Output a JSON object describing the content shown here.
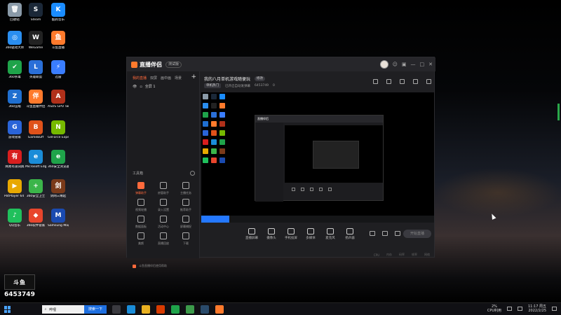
{
  "desktop": {
    "icons": [
      {
        "label": "回收站",
        "color": "#8a9aa8",
        "glyph": "🗑"
      },
      {
        "label": "Steam",
        "color": "#1b2838",
        "glyph": "S"
      },
      {
        "label": "酷狗音乐",
        "color": "#1a8cff",
        "glyph": "K"
      },
      {
        "label": "360驱动大师",
        "color": "#2a8ef0",
        "glyph": "◎"
      },
      {
        "label": "WeGame",
        "color": "#222222",
        "glyph": "W"
      },
      {
        "label": "斗鱼直播",
        "color": "#ff7a2c",
        "glyph": "鱼"
      },
      {
        "label": "360杀毒",
        "color": "#1fa34a",
        "glyph": "✔"
      },
      {
        "label": "英雄联盟",
        "color": "#2a6fd8",
        "glyph": "L"
      },
      {
        "label": "迅雷",
        "color": "#3a7dff",
        "glyph": "⚡"
      },
      {
        "label": "360压缩",
        "color": "#1f6fd0",
        "glyph": "Z"
      },
      {
        "label": "斗鱼直播伴侣",
        "color": "#ff7a2c",
        "glyph": "伴"
      },
      {
        "label": "ASUS GPU Tweak II",
        "color": "#b0301a",
        "glyph": "A"
      },
      {
        "label": "游戏管家",
        "color": "#2a64d8",
        "glyph": "G"
      },
      {
        "label": "GameBuff",
        "color": "#e0521a",
        "glyph": "B"
      },
      {
        "label": "GeForce Experience",
        "color": "#76b900",
        "glyph": "N"
      },
      {
        "label": "网易有道词典",
        "color": "#d81e1e",
        "glyph": "有"
      },
      {
        "label": "Microsoft Edge",
        "color": "#1a8cd8",
        "glyph": "e"
      },
      {
        "label": "360安全浏览器",
        "color": "#1fa34a",
        "glyph": "e"
      },
      {
        "label": "PotPlayer 64 bit",
        "color": "#e8a800",
        "glyph": "▶"
      },
      {
        "label": "360安全卫士",
        "color": "#3bb54a",
        "glyph": "+"
      },
      {
        "label": "剑网三缘起",
        "color": "#7a3a1a",
        "glyph": "剑"
      },
      {
        "label": "QQ音乐",
        "color": "#20c05c",
        "glyph": "♪"
      },
      {
        "label": "360软件管家",
        "color": "#e8452c",
        "glyph": "◆"
      },
      {
        "label": "Samsung Magician",
        "color": "#1a4ab0",
        "glyph": "M"
      }
    ]
  },
  "overlay": {
    "logo": "斗鱼",
    "room_number": "6453749"
  },
  "app": {
    "name": "直播伴侣",
    "version_badge": "测试版",
    "window_controls": [
      "☺",
      "▣",
      "—",
      "□",
      "✕"
    ],
    "sidebar": {
      "tabs": [
        "我的直播",
        "双屏",
        "画中画",
        "场景"
      ],
      "add": "+",
      "scene_label": "全屏 1",
      "tools_title": "工具箱",
      "tools": [
        {
          "label": "弹幕助手",
          "hot": true
        },
        {
          "label": "房管助手",
          "hot": false
        },
        {
          "label": "主播任务",
          "hot": false
        },
        {
          "label": "视频轮播",
          "hot": false
        },
        {
          "label": "录入设置",
          "hot": false
        },
        {
          "label": "推荐助手",
          "hot": false
        },
        {
          "label": "数据面板",
          "hot": false
        },
        {
          "label": "活动中心",
          "hot": false
        },
        {
          "label": "屏幕捕捉",
          "hot": false
        },
        {
          "label": "美颜",
          "hot": false
        },
        {
          "label": "直播回放",
          "hot": false
        },
        {
          "label": "下载",
          "hot": false
        }
      ],
      "bottom_text": "斗鱼直播伴侣使用帮助"
    },
    "room": {
      "title": "我的八月单机游戏随便玩",
      "title_badge": "修改",
      "category": "单机热门",
      "subtitle": "已开启自动发弹幕",
      "room_id": "6453749",
      "fans": "0"
    },
    "controls": [
      {
        "label": "直播屏幕",
        "icon": "screen-icon"
      },
      {
        "label": "摄像头",
        "icon": "camera-icon"
      },
      {
        "label": "手机投屏",
        "icon": "phone-cast-icon"
      },
      {
        "label": "多媒体",
        "icon": "media-icon"
      },
      {
        "label": "麦克风",
        "icon": "microphone-icon"
      },
      {
        "label": "扬声器",
        "icon": "speaker-icon"
      }
    ],
    "start_button": "开始直播",
    "status_items": [
      "CPU",
      "内存",
      "码率",
      "帧率",
      "网络"
    ]
  },
  "taskbar": {
    "search_text": "哔哩",
    "search_button": "搜索一下",
    "cpu_percent": "2%",
    "cpu_label": "CPU利用",
    "time": "11:17 周五",
    "date": "2022/2/25",
    "apps": [
      {
        "name": "task-view",
        "color": "#3a3a40"
      },
      {
        "name": "edge",
        "color": "#1a8cd8"
      },
      {
        "name": "explorer",
        "color": "#e8b020"
      },
      {
        "name": "office",
        "color": "#d83b01"
      },
      {
        "name": "360browser",
        "color": "#1fa34a"
      },
      {
        "name": "chrome",
        "color": "#3c9a4a"
      },
      {
        "name": "steam",
        "color": "#2a4a6a"
      },
      {
        "name": "douyu-companion",
        "color": "#ff7a2c"
      }
    ]
  }
}
